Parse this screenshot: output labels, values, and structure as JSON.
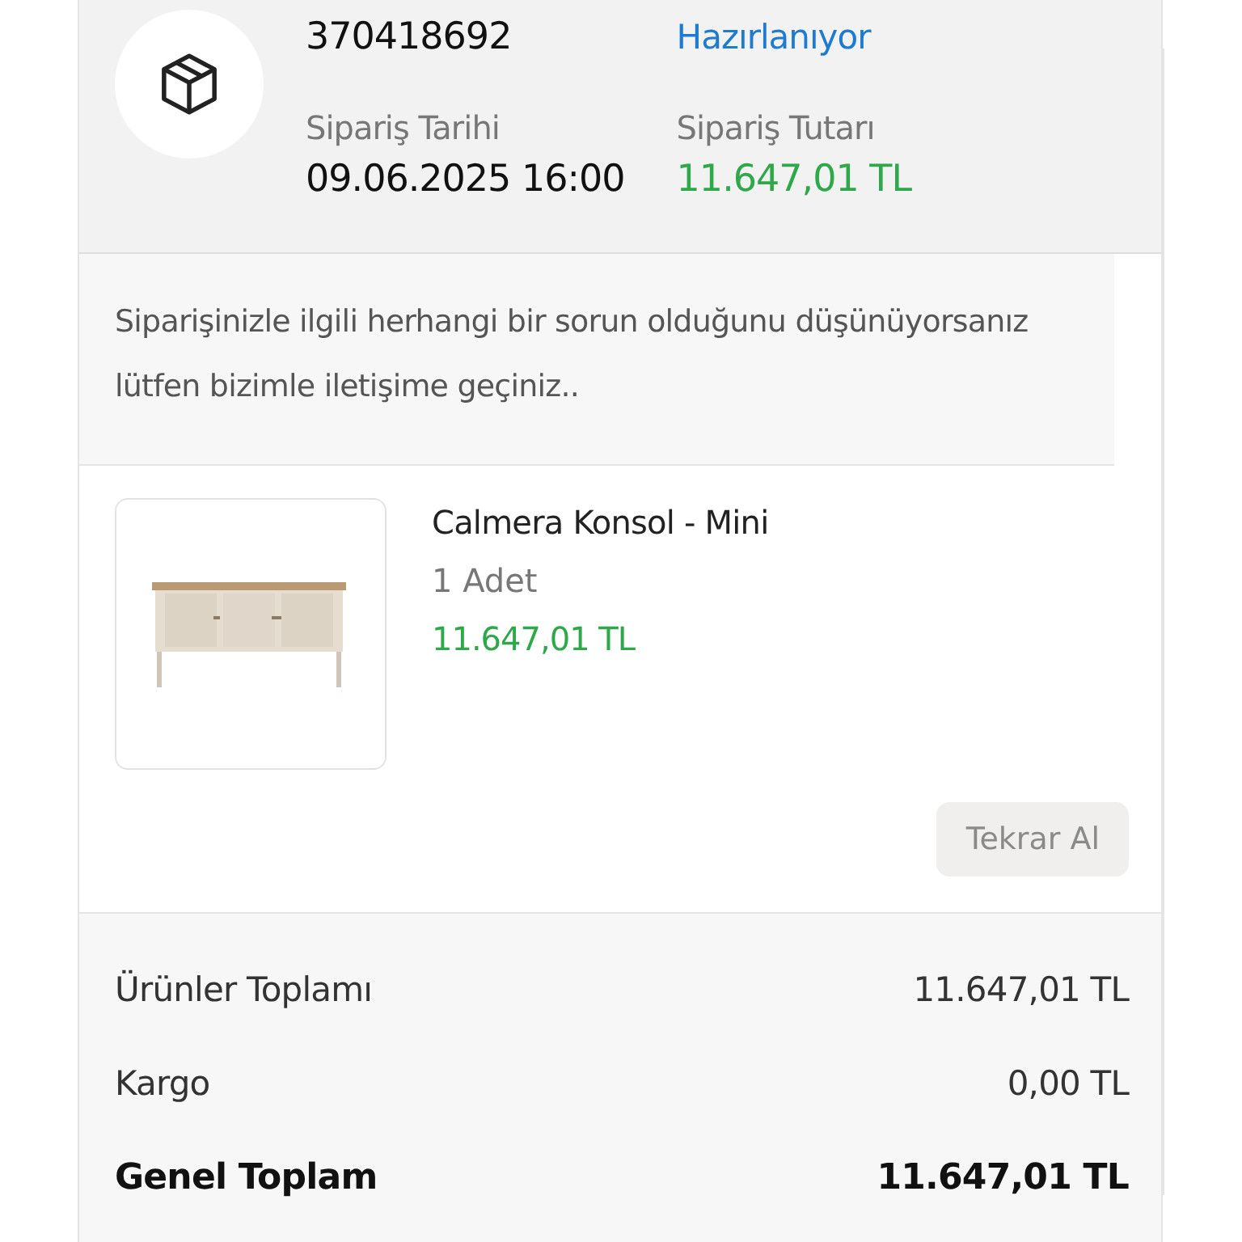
{
  "order": {
    "number": "370418692",
    "status": "Hazırlanıyor",
    "date_label": "Sipariş Tarihi",
    "date": "09.06.2025 16:00",
    "total_label": "Sipariş Tutarı",
    "total": "11.647,01 TL"
  },
  "notice": "Siparişinizle ilgili herhangi bir sorun olduğunu düşünüyorsanız lütfen bizimle iletişime geçiniz..",
  "product": {
    "name": "Calmera Konsol - Mini",
    "quantity": "1 Adet",
    "price": "11.647,01 TL",
    "button": {
      "label": "Tekrar Al",
      "disabled": true
    }
  },
  "summary": [
    {
      "label": "Ürünler Toplamı",
      "value": "11.647,01 TL",
      "kind": "normal"
    },
    {
      "label": "Kargo",
      "value": "0,00 TL",
      "kind": "normal"
    },
    {
      "label": "Genel Toplam",
      "value": "11.647,01 TL",
      "kind": "total"
    }
  ]
}
